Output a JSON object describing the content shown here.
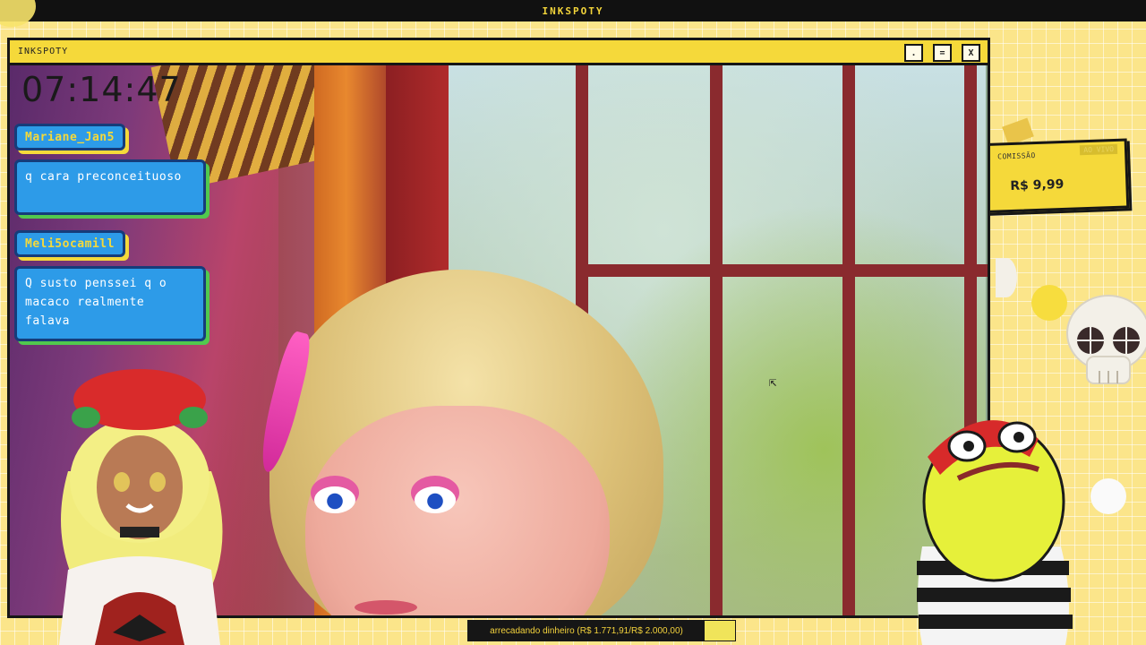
{
  "app": {
    "top_title": "INKSPOTY"
  },
  "window": {
    "title": "INKSPOTY",
    "buttons": {
      "minimize": ".",
      "maximize": "=",
      "close": "X"
    }
  },
  "stream": {
    "clock": "07:14:47"
  },
  "chat": [
    {
      "user": "Mariane_Jan5",
      "message": "q cara preconceituoso"
    },
    {
      "user": "Meli5ocamill",
      "message": "Q susto penssei q o macaco realmente falava"
    }
  ],
  "commission": {
    "label": "COMISSÃO",
    "badge": "AO VIVO",
    "price": "R$ 9,99"
  },
  "goal": {
    "text": "arrecadando dinheiro (R$ 1.771,91/R$ 2.000,00)",
    "progress_fraction": 0.886,
    "colors": {
      "bar": "#161616",
      "remaining": "#f0e45a",
      "text": "#f3d23c"
    }
  },
  "colors": {
    "accent_yellow": "#f5d93a",
    "chat_blue": "#2d9be8",
    "chat_border": "#163c7a",
    "background_yellow": "#fbe58a"
  },
  "icons": {
    "cursor": "mouse-pointer-icon",
    "star": "star-icon",
    "skull": "skull-icon"
  }
}
